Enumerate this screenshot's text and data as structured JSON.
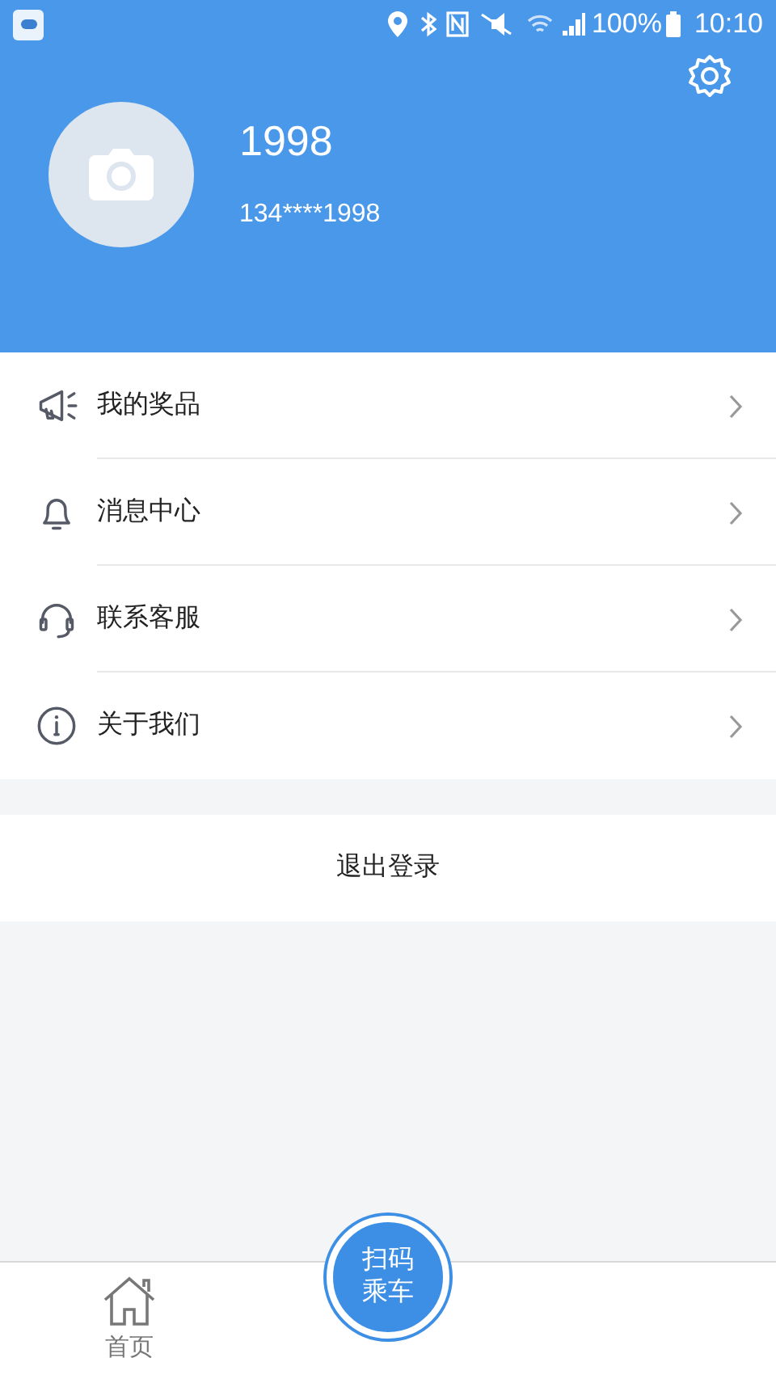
{
  "status_bar": {
    "battery": "100%",
    "time": "10:10"
  },
  "profile": {
    "name": "1998",
    "phone": "134****1998"
  },
  "menu": [
    {
      "kind": "megaphone",
      "label": "我的奖品"
    },
    {
      "kind": "bell",
      "label": "消息中心"
    },
    {
      "kind": "headset",
      "label": "联系客服"
    },
    {
      "kind": "info",
      "label": "关于我们"
    }
  ],
  "logout": "退出登录",
  "tab_bar": {
    "tabs": [
      {
        "label": "首页",
        "selected": false
      }
    ],
    "scan_button": [
      "扫码",
      "乘车"
    ]
  }
}
